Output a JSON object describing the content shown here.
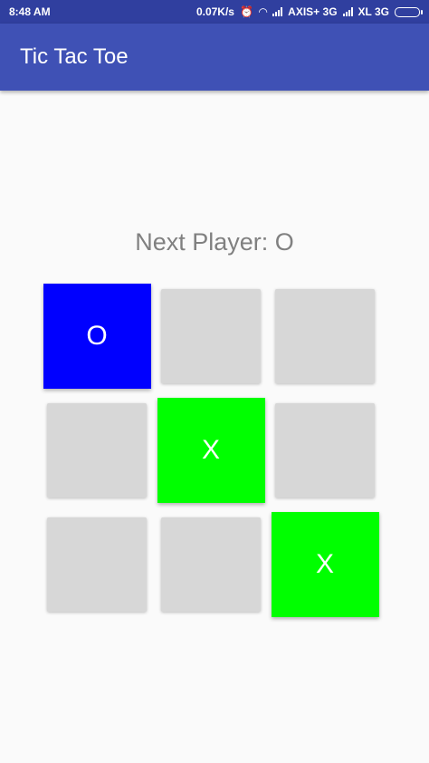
{
  "status_bar": {
    "time": "8:48 AM",
    "speed": "0.07K/s",
    "carrier1": "AXIS+ 3G",
    "carrier2": "XL 3G"
  },
  "app_bar": {
    "title": "Tic Tac Toe"
  },
  "game": {
    "next_player_label": "Next Player: O",
    "cells": [
      {
        "mark": "O",
        "state": "o"
      },
      {
        "mark": "",
        "state": "empty"
      },
      {
        "mark": "",
        "state": "empty"
      },
      {
        "mark": "",
        "state": "empty"
      },
      {
        "mark": "X",
        "state": "x"
      },
      {
        "mark": "",
        "state": "empty"
      },
      {
        "mark": "",
        "state": "empty"
      },
      {
        "mark": "",
        "state": "empty"
      },
      {
        "mark": "X",
        "state": "x"
      }
    ]
  },
  "colors": {
    "status_bar": "#303f9f",
    "app_bar": "#3f51b5",
    "o_cell": "#0000ff",
    "x_cell": "#00ff00",
    "empty_cell": "#d7d7d7"
  }
}
